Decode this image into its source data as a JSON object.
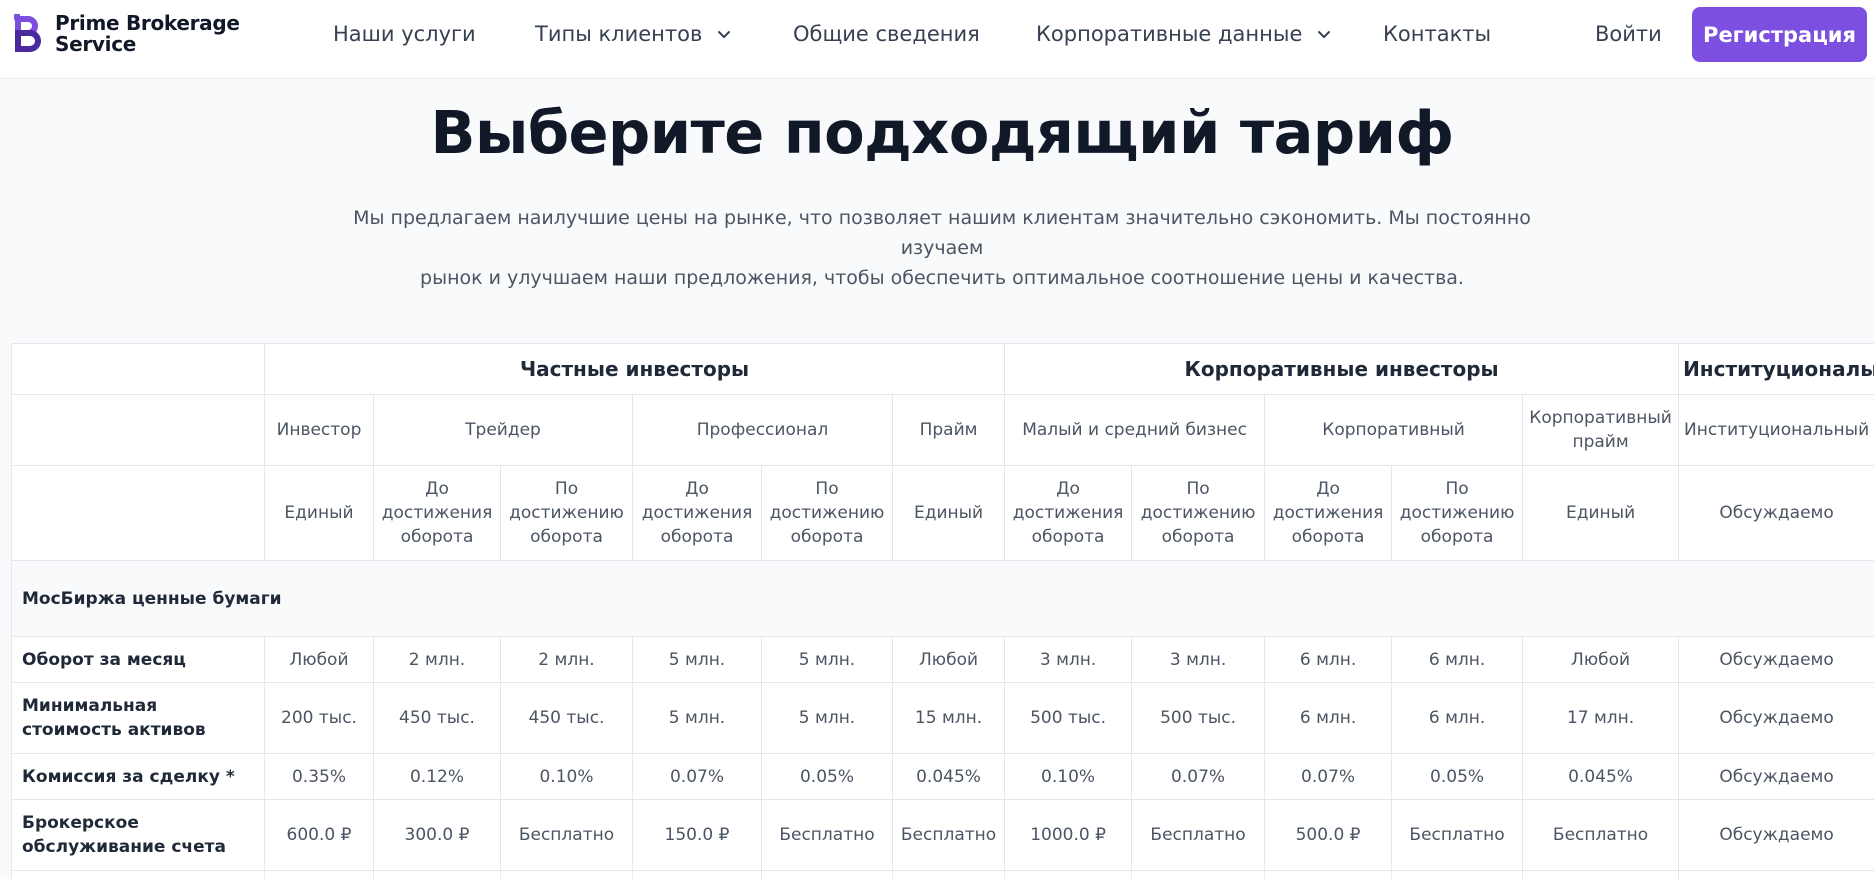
{
  "nav": {
    "brand_line1": "Prime Brokerage",
    "brand_line2": "Service",
    "items": [
      {
        "label": "Наши услуги"
      },
      {
        "label": "Типы клиентов"
      },
      {
        "label": "Общие сведения"
      },
      {
        "label": "Корпоративные данные"
      },
      {
        "label": "Контакты"
      }
    ],
    "login_label": "Войти",
    "register_label": "Регистрация",
    "accent_color": "#7c4fe0"
  },
  "hero": {
    "title": "Выберите подходящий тариф",
    "subtitle_line1": "Мы предлагаем наилучшие цены на рынке, что позволяет нашим клиентам значительно сэкономить. Мы постоянно изучаем",
    "subtitle_line2": "рынок и улучшаем наши предложения, чтобы обеспечить оптимальное соотношение цены и качества."
  },
  "table": {
    "groups": [
      "Частные инвесторы",
      "Корпоративные инвесторы",
      "Институционалы"
    ],
    "tiers": [
      "Инвестор",
      "Трейдер",
      "Профессионал",
      "Прайм",
      "Малый и средний бизнес",
      "Корпоративный",
      "Корпоративный прайм",
      "Институциональный"
    ],
    "models": [
      {
        "l1": "Единый",
        "l2": "",
        "l3": ""
      },
      {
        "l1": "До",
        "l2": "достижения",
        "l3": "оборота"
      },
      {
        "l1": "По",
        "l2": "достижению",
        "l3": "оборота"
      },
      {
        "l1": "До",
        "l2": "достижения",
        "l3": "оборота"
      },
      {
        "l1": "По",
        "l2": "достижению",
        "l3": "оборота"
      },
      {
        "l1": "Единый",
        "l2": "",
        "l3": ""
      },
      {
        "l1": "До",
        "l2": "достижения",
        "l3": "оборота"
      },
      {
        "l1": "По",
        "l2": "достижению",
        "l3": "оборота"
      },
      {
        "l1": "До",
        "l2": "достижения",
        "l3": "оборота"
      },
      {
        "l1": "По",
        "l2": "достижению",
        "l3": "оборота"
      },
      {
        "l1": "Единый",
        "l2": "",
        "l3": ""
      },
      {
        "l1": "Обсуждаемо",
        "l2": "",
        "l3": ""
      }
    ],
    "section_label": "МосБиржа ценные бумаги",
    "rows": [
      {
        "label": "Оборот за месяц",
        "cells": [
          "Любой",
          "2 млн.",
          "2 млн.",
          "5 млн.",
          "5 млн.",
          "Любой",
          "3 млн.",
          "3 млн.",
          "6 млн.",
          "6 млн.",
          "Любой",
          "Обсуждаемо"
        ]
      },
      {
        "label": "Минимальная стоимость активов",
        "cells": [
          "200 тыс.",
          "450 тыс.",
          "450 тыс.",
          "5 млн.",
          "5 млн.",
          "15 млн.",
          "500 тыс.",
          "500 тыс.",
          "6 млн.",
          "6 млн.",
          "17 млн.",
          "Обсуждаемо"
        ]
      },
      {
        "label": "Комиссия за сделку *",
        "cells": [
          "0.35%",
          "0.12%",
          "0.10%",
          "0.07%",
          "0.05%",
          "0.045%",
          "0.10%",
          "0.07%",
          "0.07%",
          "0.05%",
          "0.045%",
          "Обсуждаемо"
        ]
      },
      {
        "label": "Брокерское обслуживание счета",
        "cells": [
          "600.0 ₽",
          "300.0 ₽",
          "Бесплатно",
          "150.0 ₽",
          "Бесплатно",
          "Бесплатно",
          "1000.0 ₽",
          "Бесплатно",
          "500.0 ₽",
          "Бесплатно",
          "Бесплатно",
          "Обсуждаемо"
        ]
      }
    ]
  }
}
